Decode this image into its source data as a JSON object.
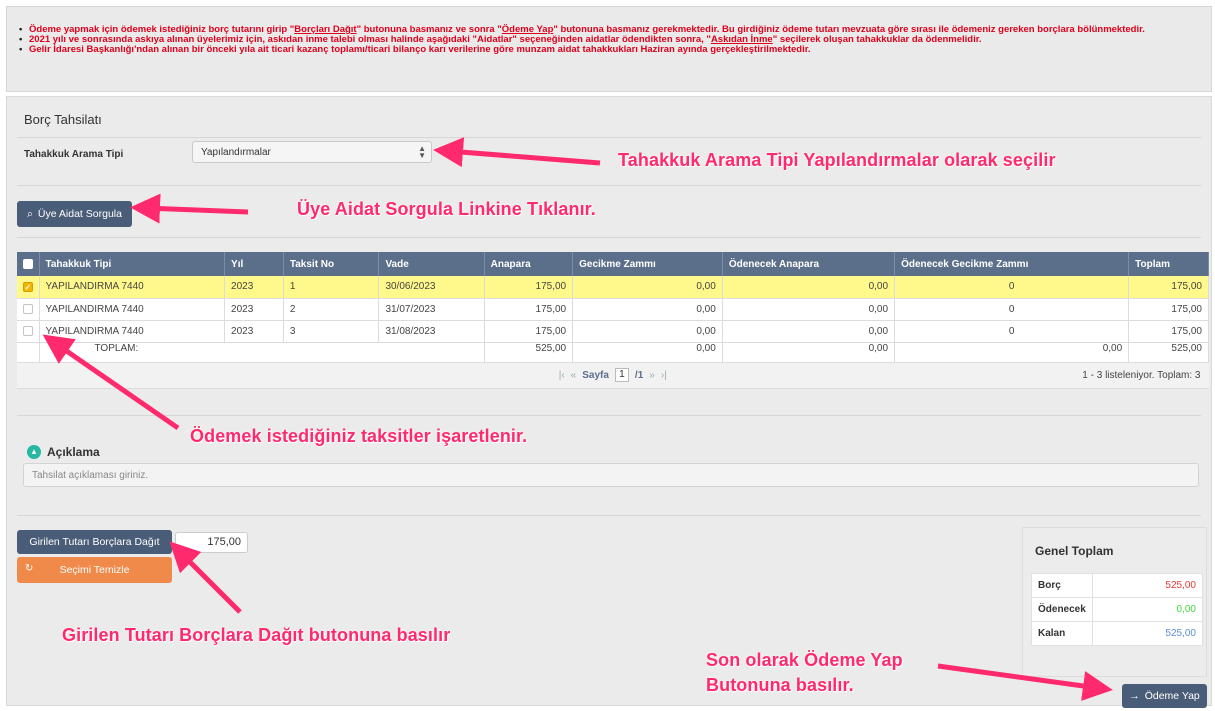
{
  "notice": {
    "lines": [
      [
        "Ödeme yapmak için ödemek istediğiniz borç tutarını girip \"",
        "Borçları Dağıt",
        "\" butonuna basmanız ve sonra \"",
        "Ödeme Yap",
        "\" butonuna basmanız gerekmektedir. Bu girdiğiniz ödeme tutarı mevzuata göre sırası ile ödemeniz gereken borçlara bölünmektedir."
      ],
      [
        "2021 yılı ve sonrasında askıya alınan üyelerimiz için, askıdan inme talebi olması halinde aşağıdaki \"Aidatlar\" seçeneğinden aidatlar ödendikten sonra, \"",
        "Askıdan İnme",
        "\" seçilerek oluşan tahakkuklar da ödenmelidir."
      ],
      [
        "Gelir İdaresi Başkanlığı'ndan alınan bir önceki yıla ait ticari kazanç toplamı/ticari bilanço karı verilerine göre munzam aidat tahakkukları Haziran ayında gerçekleştirilmektedir."
      ]
    ]
  },
  "section_title": "Borç Tahsilatı",
  "search": {
    "label": "Tahakkuk Arama Tipi",
    "selected": "Yapılandırmalar",
    "sorgula_label": "Üye Aidat Sorgula"
  },
  "table": {
    "columns": [
      "Tahakkuk Tipi",
      "Yıl",
      "Taksit No",
      "Vade",
      "Anapara",
      "Gecikme Zammı",
      "Ödenecek Anapara",
      "Ödenecek Gecikme Zammı",
      "Toplam"
    ],
    "rows": [
      {
        "checked": true,
        "cells": [
          "YAPILANDIRMA 7440",
          "2023",
          "1",
          "30/06/2023",
          "175,00",
          "0,00",
          "0,00",
          "0",
          "175,00"
        ]
      },
      {
        "checked": false,
        "cells": [
          "YAPILANDIRMA 7440",
          "2023",
          "2",
          "31/07/2023",
          "175,00",
          "0,00",
          "0,00",
          "0",
          "175,00"
        ]
      },
      {
        "checked": false,
        "cells": [
          "YAPILANDIRMA 7440",
          "2023",
          "3",
          "31/08/2023",
          "175,00",
          "0,00",
          "0,00",
          "0",
          "175,00"
        ]
      }
    ],
    "totals": {
      "label": "TOPLAM:",
      "values": [
        "525,00",
        "0,00",
        "0,00",
        "0,00",
        "525,00"
      ]
    },
    "pager": {
      "page_label": "Sayfa",
      "page": "1",
      "of": "/1",
      "info": "1 - 3 listeleniyor. Toplam: 3"
    }
  },
  "aciklama": {
    "title": "Açıklama",
    "placeholder": "Tahsilat açıklaması giriniz."
  },
  "dagit": {
    "button": "Girilen Tutarı Borçlara Dağıt",
    "amount": "175,00",
    "temizle": "Seçimi Temizle"
  },
  "genel": {
    "title": "Genel Toplam",
    "rows": [
      {
        "label": "Borç",
        "value": "525,00",
        "color": "#e53935"
      },
      {
        "label": "Ödenecek",
        "value": "0,00",
        "color": "#3ddc3d"
      },
      {
        "label": "Kalan",
        "value": "525,00",
        "color": "#5c8fd6"
      }
    ]
  },
  "odeme_button": "Ödeme Yap",
  "annotations": {
    "a1": "Tahakkuk Arama Tipi Yapılandırmalar olarak seçilir",
    "a2": "Üye Aidat Sorgula Linkine Tıklanır.",
    "a3": "Ödemek istediğiniz taksitler işaretlenir.",
    "a4": "Girilen Tutarı Borçlara Dağıt butonuna basılır",
    "a5_line1": "Son olarak Ödeme Yap",
    "a5_line2": "Butonuna basılır."
  },
  "colors": {
    "accent": "#ff2a6d",
    "header": "#5b6f8b",
    "button": "#4a5d78",
    "clear": "#f08a4b",
    "highlight": "#fff88a"
  }
}
